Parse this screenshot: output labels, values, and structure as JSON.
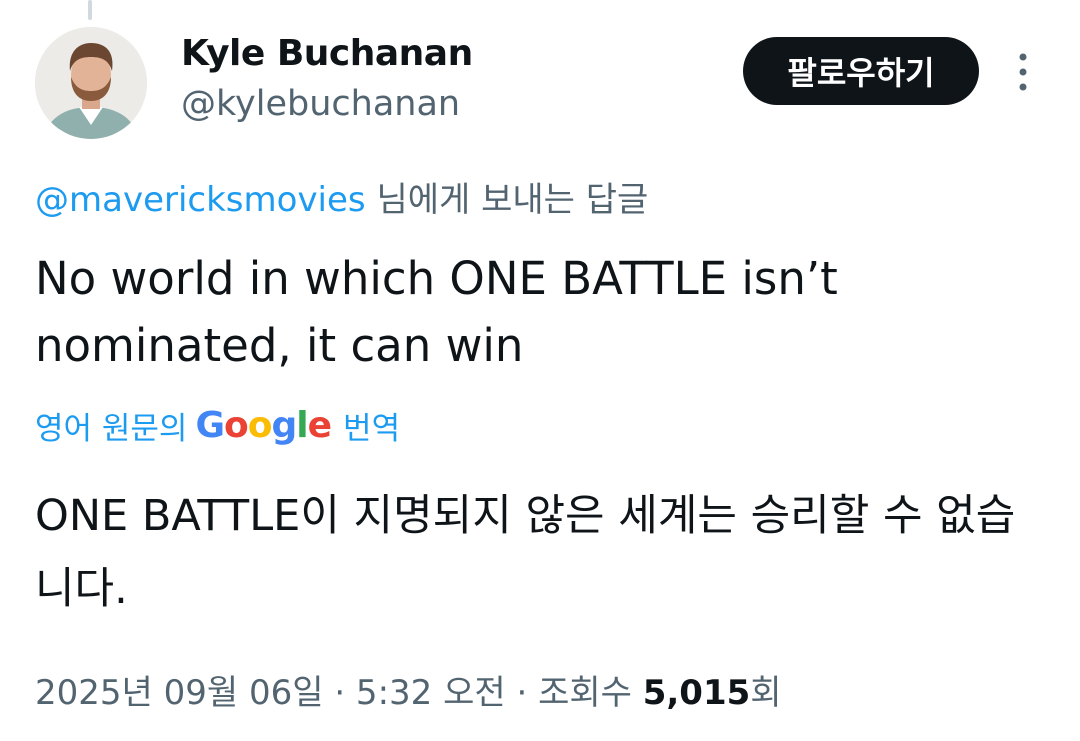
{
  "author": {
    "name": "Kyle Buchanan",
    "handle": "@kylebuchanan",
    "avatar_icon": "profile-photo"
  },
  "follow_button": {
    "label": "팔로우하기"
  },
  "more_icon": "more-vertical-icon",
  "reply_context": {
    "mention": "@mavericksmovies",
    "suffix": "님에게 보내는 답글"
  },
  "tweet": {
    "text": "No world in which ONE BATTLE isn’t nominated, it can win"
  },
  "translation": {
    "prefix": "영어 원문의",
    "provider_letters": [
      "G",
      "o",
      "o",
      "g",
      "l",
      "e"
    ],
    "suffix": "번역",
    "text": "ONE BATTLE이 지명되지 않은 세계는 승리할 수 없습니다."
  },
  "meta": {
    "datetime": "2025년 09월 06일 · 5:32 오전 · 조회수",
    "views": "5,015",
    "views_suffix": "회"
  },
  "colors": {
    "link": "#1d9bf0",
    "secondary_text": "#536471",
    "primary_text": "#0f1419",
    "button_bg": "#0f1419"
  }
}
